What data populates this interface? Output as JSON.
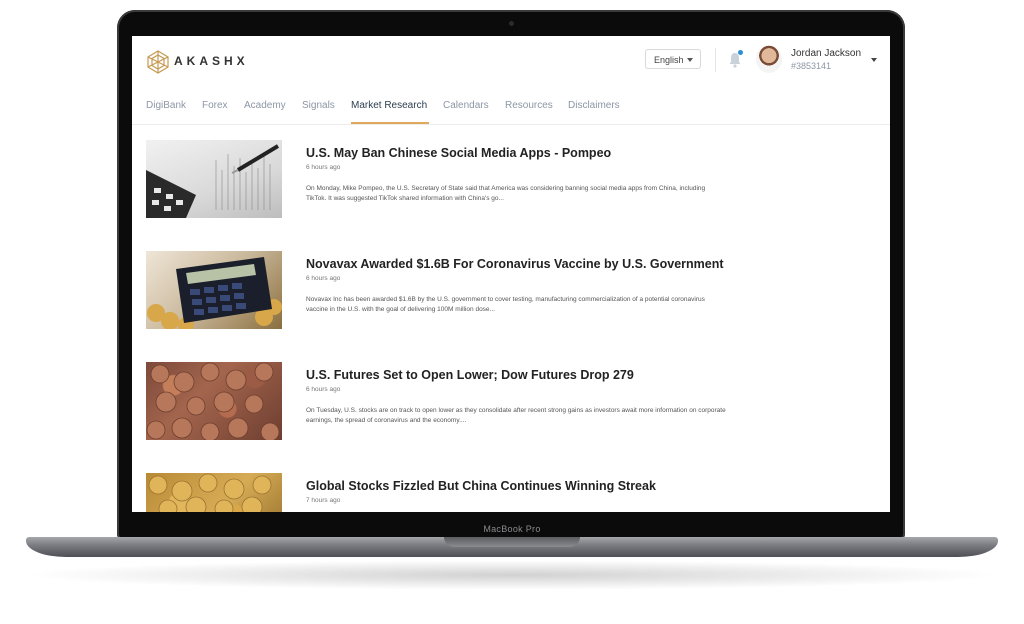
{
  "device": {
    "model_label": "MacBook Pro"
  },
  "app": {
    "brand": "AKASHX"
  },
  "header": {
    "language": "English",
    "user": {
      "name": "Jordan Jackson",
      "id": "#3853141"
    }
  },
  "nav": {
    "items": [
      {
        "label": "DigiBank",
        "active": false
      },
      {
        "label": "Forex",
        "active": false
      },
      {
        "label": "Academy",
        "active": false
      },
      {
        "label": "Signals",
        "active": false
      },
      {
        "label": "Market Research",
        "active": true
      },
      {
        "label": "Calendars",
        "active": false
      },
      {
        "label": "Resources",
        "active": false
      },
      {
        "label": "Disclaimers",
        "active": false
      }
    ]
  },
  "articles": [
    {
      "title": "U.S. May Ban Chinese Social Media Apps - Pompeo",
      "time": "6 hours ago",
      "excerpt": "On Monday, Mike Pompeo, the U.S. Secretary of State said that America was considering banning social media apps from China, including TikTok. It was suggested TikTok shared information with China's go...",
      "thumbnail": "pen-chart-calculator"
    },
    {
      "title": "Novavax Awarded $1.6B For Coronavirus Vaccine by U.S. Government",
      "time": "6 hours ago",
      "excerpt": "Novavax Inc has been awarded $1.6B by the U.S. government to cover testing, manufacturing commercialization of a potential coronavirus vaccine in the U.S. with the goal of delivering 100M million dose...",
      "thumbnail": "calculator-coins"
    },
    {
      "title": "U.S. Futures Set to Open Lower; Dow Futures Drop 279",
      "time": "6 hours ago",
      "excerpt": "On Tuesday, U.S. stocks are on track to open lower as they consolidate after recent strong gains as investors await more information on corporate earnings, the spread of coronavirus and the economy....",
      "thumbnail": "copper-coins"
    },
    {
      "title": "Global Stocks Fizzled But China Continues Winning Streak",
      "time": "7 hours ago",
      "excerpt": "",
      "thumbnail": "gold-coins"
    }
  ],
  "colors": {
    "accent": "#e0a85a",
    "nav_text": "#8c97a6",
    "notification": "#2b8ed6"
  }
}
